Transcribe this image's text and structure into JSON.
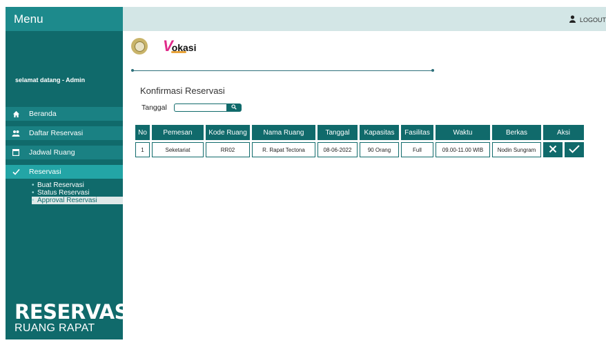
{
  "sidebar": {
    "menu_title": "Menu",
    "welcome": "selamat datang - Admin",
    "items": [
      {
        "label": "Beranda",
        "icon": "home-icon"
      },
      {
        "label": "Daftar Reservasi",
        "icon": "users-icon"
      },
      {
        "label": "Jadwal Ruang",
        "icon": "calendar-icon"
      },
      {
        "label": "Reservasi",
        "icon": "check-icon"
      }
    ],
    "sub_items": [
      "Buat Reservasi",
      "Status Reservasi",
      "Approval Reservasi"
    ],
    "brand_line1": "RESERVASI",
    "brand_line2": "RUANG RAPAT"
  },
  "topbar": {
    "logout_label": "LOGOUT"
  },
  "logo": {
    "vokasi_v": "V",
    "vokasi_rest": "okasi"
  },
  "main": {
    "title": "Konfirmasi Reservasi",
    "filter_label": "Tanggal",
    "filter_value": ""
  },
  "table": {
    "headers": [
      "No",
      "Pemesan",
      "Kode Ruang",
      "Nama Ruang",
      "Tanggal",
      "Kapasitas",
      "Fasilitas",
      "Waktu",
      "Berkas",
      "Aksi"
    ],
    "rows": [
      [
        "1",
        "Seketariat",
        "RR02",
        "R. Rapat Tectona",
        "08-06-2022",
        "90 Orang",
        "Full",
        "09.00-11.00 WIB",
        "Nodin Sungram"
      ]
    ]
  },
  "colors": {
    "primary": "#106a6b",
    "menu_header": "#1d8a8c",
    "topbar": "#d3e6e6",
    "logo_pink": "#e02b8a"
  }
}
